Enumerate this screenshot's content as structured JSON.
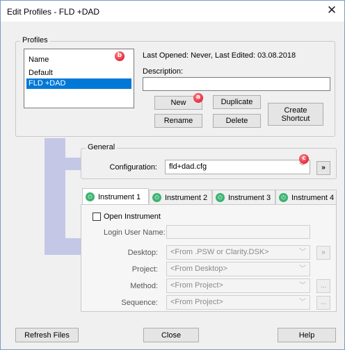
{
  "window": {
    "title": "Edit Profiles - FLD +DAD",
    "close_glyph": "✕"
  },
  "profiles": {
    "group_label": "Profiles",
    "list_header": "Name",
    "items": [
      "Default",
      "FLD +DAD"
    ],
    "selected_index": 1,
    "info": "Last Opened: Never, Last Edited: 03.08.2018",
    "description_label": "Description:",
    "description_value": "",
    "buttons": {
      "new": "New",
      "duplicate": "Duplicate",
      "rename": "Rename",
      "delete": "Delete",
      "create_shortcut": "Create Shortcut"
    }
  },
  "badges": {
    "a": "a",
    "b": "b",
    "c": "c"
  },
  "general": {
    "group_label": "General",
    "configuration_label": "Configuration:",
    "configuration_value": "fld+dad.cfg",
    "more_button": "»"
  },
  "tabs": [
    {
      "label": "Instrument 1"
    },
    {
      "label": "Instrument 2"
    },
    {
      "label": "Instrument 3"
    },
    {
      "label": "Instrument 4"
    }
  ],
  "instrument": {
    "open_instrument_label": "Open Instrument",
    "login_user_label": "Login User Name:",
    "login_user_value": "",
    "desktop_label": "Desktop:",
    "desktop_value": "<From .PSW or Clarity.DSK>",
    "desktop_button": "»",
    "project_label": "Project:",
    "project_value": "<From Desktop>",
    "method_label": "Method:",
    "method_value": "<From Project>",
    "method_button": "...",
    "sequence_label": "Sequence:",
    "sequence_value": "<From Project>",
    "sequence_button": "..."
  },
  "footer": {
    "refresh": "Refresh Files",
    "close": "Close",
    "help": "Help"
  },
  "colors": {
    "accent": "#0078d7",
    "bracket": "#c4c7e6",
    "badge": "#d9001b",
    "tab_icon": "#3cb371"
  }
}
